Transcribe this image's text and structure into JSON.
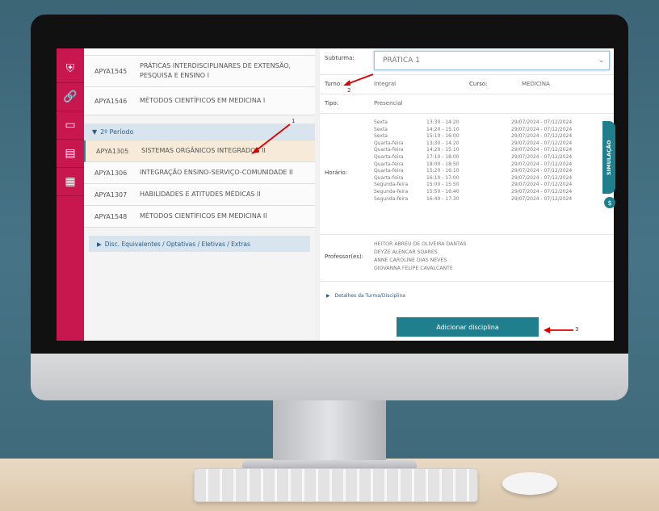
{
  "sidebar": {
    "icons": [
      "shield-icon",
      "link-icon",
      "book-icon",
      "document-icon",
      "calendar-icon"
    ]
  },
  "list": {
    "rows_top": [
      {
        "code": "APYA1545",
        "name": "PRÁTICAS INTERDISCIPLINARES DE EXTENSÃO, PESQUISA E ENSINO I"
      },
      {
        "code": "APYA1546",
        "name": "MÉTODOS CIENTÍFICOS EM MEDICINA I"
      }
    ],
    "period_label": "2º Período",
    "rows_period": [
      {
        "code": "APYA1305",
        "name": "SISTEMAS ORGÂNICOS INTEGRADOS II"
      },
      {
        "code": "APYA1306",
        "name": "INTEGRAÇÃO ENSINO-SERVIÇO-COMUNIDADE II"
      },
      {
        "code": "APYA1307",
        "name": "HABILIDADES E ATITUDES MÉDICAS II"
      },
      {
        "code": "APYA1548",
        "name": "MÉTODOS CIENTÍFICOS EM MEDICINA II"
      }
    ],
    "accordion_label": "Disc. Equivalentes / Optativas / Eletivas / Extras"
  },
  "detail": {
    "subturma_label": "Subturma:",
    "subturma_value": "PRÁTICA 1",
    "turno_label": "Turno:",
    "turno_value": "Integral",
    "curso_label": "Curso:",
    "curso_value": "MEDICINA",
    "tipo_label": "Tipo:",
    "tipo_value": "Presencial",
    "horario_label": "Horário:",
    "schedule": [
      {
        "day": "Sexta",
        "time": "13:30 - 14:20",
        "date": "29/07/2024 - 07/12/2024"
      },
      {
        "day": "Sexta",
        "time": "14:20 - 15:10",
        "date": "29/07/2024 - 07/12/2024"
      },
      {
        "day": "Sexta",
        "time": "15:10 - 16:00",
        "date": "29/07/2024 - 07/12/2024"
      },
      {
        "day": "Quarta-feira",
        "time": "13:30 - 14:20",
        "date": "29/07/2024 - 07/12/2024"
      },
      {
        "day": "Quarta-feira",
        "time": "14:20 - 15:10",
        "date": "29/07/2024 - 07/12/2024"
      },
      {
        "day": "Quarta-feira",
        "time": "17:10 - 18:00",
        "date": "29/07/2024 - 07/12/2024"
      },
      {
        "day": "Quarta-feira",
        "time": "18:00 - 18:50",
        "date": "29/07/2024 - 07/12/2024"
      },
      {
        "day": "Quarta-feira",
        "time": "15:20 - 16:10",
        "date": "29/07/2024 - 07/12/2024"
      },
      {
        "day": "Quarta-feira",
        "time": "16:10 - 17:00",
        "date": "29/07/2024 - 07/12/2024"
      },
      {
        "day": "Segunda-feira",
        "time": "15:00 - 15:50",
        "date": "29/07/2024 - 07/12/2024"
      },
      {
        "day": "Segunda-feira",
        "time": "15:50 - 16:40",
        "date": "29/07/2024 - 07/12/2024"
      },
      {
        "day": "Segunda-feira",
        "time": "16:40 - 17:30",
        "date": "29/07/2024 - 07/12/2024"
      }
    ],
    "professor_label": "Professor(es):",
    "professors": [
      "HEITOR ABREU DE OLIVEIRA DANTAS",
      "DEYZE ALENCAR SOARES",
      "ANNE CAROLINE DIAS NEVES",
      "GIOVANNA FELIPE CAVALCANTE"
    ],
    "details_link": "Detalhes da Turma/Disciplina",
    "add_button": "Adicionar disciplina"
  },
  "simulation_tab": "SIMULAÇÃO",
  "simulation_icon": "$",
  "annotations": {
    "one": "1",
    "two": "2",
    "three": "3"
  },
  "colors": {
    "sidebar": "#c8174f",
    "accent": "#1f7f8c",
    "period": "#d8e4ee",
    "annotation": "#c00000"
  }
}
